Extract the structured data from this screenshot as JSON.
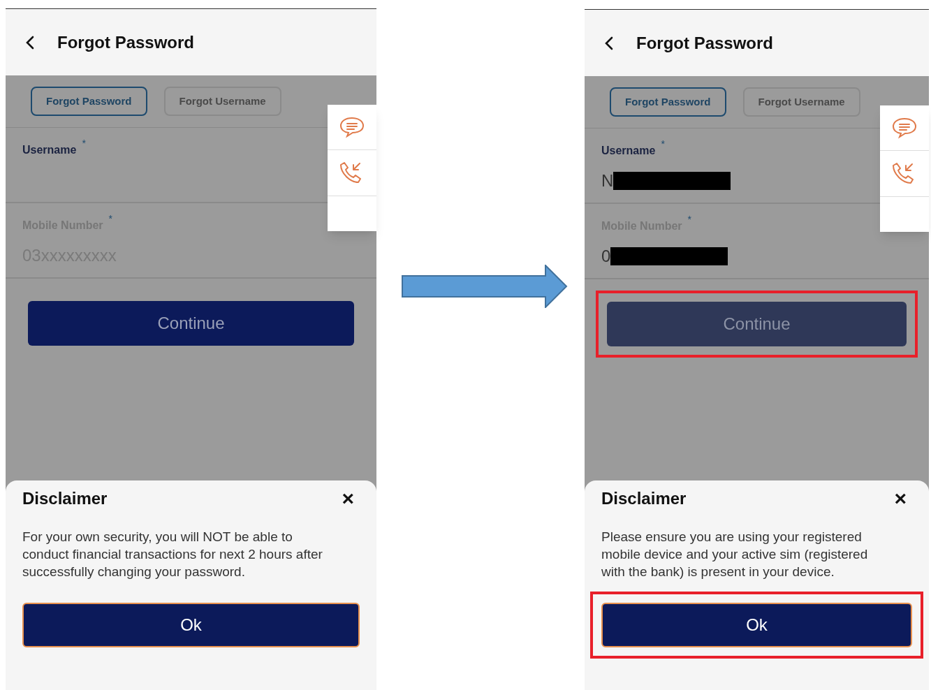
{
  "screens": [
    {
      "title": "Forgot Password",
      "tabs": [
        {
          "label": "Forgot Password",
          "selected": true
        },
        {
          "label": "Forgot Username",
          "selected": false
        }
      ],
      "fields": [
        {
          "label": "Username",
          "required": "*",
          "redacted": false,
          "active": true
        },
        {
          "label": "Mobile Number",
          "required": "*",
          "placeholder": "03xxxxxxxxx",
          "redacted": false,
          "active": false
        }
      ],
      "continue": {
        "label": "Continue",
        "disabled": false,
        "highlighted": false
      },
      "disclaimer": {
        "title": "Disclaimer",
        "close": "×",
        "text": "For your own security, you will NOT be able to conduct financial transactions for next 2 hours after successfully changing your password.",
        "ok": {
          "label": "Ok",
          "highlighted": false
        }
      }
    },
    {
      "title": "Forgot Password",
      "tabs": [
        {
          "label": "Forgot Password",
          "selected": true
        },
        {
          "label": "Forgot Username",
          "selected": false
        }
      ],
      "fields": [
        {
          "label": "Username",
          "required": "*",
          "value": "N",
          "redacted": true,
          "active": true
        },
        {
          "label": "Mobile Number",
          "required": "*",
          "value": "0",
          "redacted": true,
          "active": false
        }
      ],
      "continue": {
        "label": "Continue",
        "disabled": true,
        "highlighted": true
      },
      "disclaimer": {
        "title": "Disclaimer",
        "close": "×",
        "text": "Please ensure you are using your registered mobile device and your active sim (registered with the bank) is present in your device.",
        "ok": {
          "label": "Ok",
          "highlighted": true
        }
      }
    }
  ]
}
